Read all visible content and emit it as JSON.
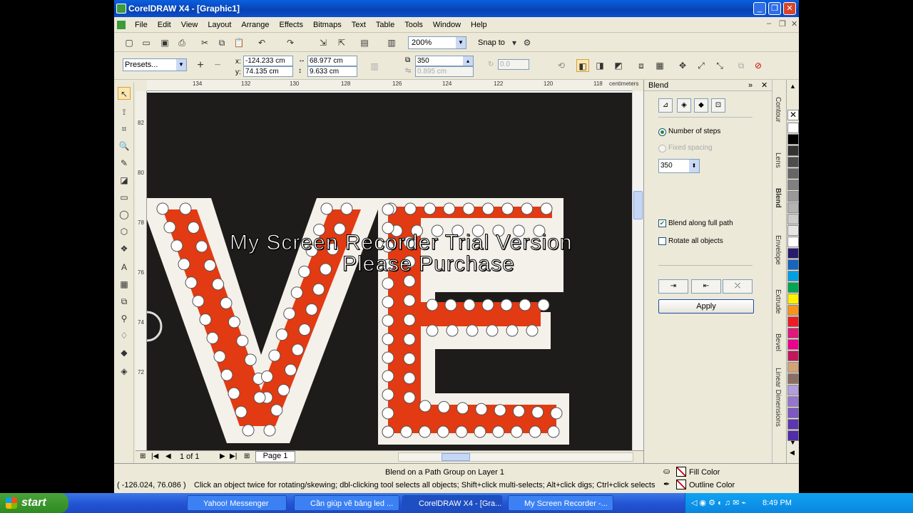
{
  "window": {
    "title": "CorelDRAW X4 - [Graphic1]"
  },
  "menu": [
    "File",
    "Edit",
    "View",
    "Layout",
    "Arrange",
    "Effects",
    "Bitmaps",
    "Text",
    "Table",
    "Tools",
    "Window",
    "Help"
  ],
  "toolbar": {
    "zoom": "200%",
    "snap_label": "Snap to"
  },
  "propbar": {
    "presets": "Presets...",
    "x_label": "x:",
    "y_label": "y:",
    "x": "-124.233 cm",
    "y": "74.135 cm",
    "width": "68.977 cm",
    "height": "9.633 cm",
    "steps": "350",
    "spacing": "0.895 cm",
    "angle": "0.0"
  },
  "ruler": {
    "top_ticks": [
      "134",
      "132",
      "130",
      "128",
      "126",
      "124",
      "122",
      "120",
      "118"
    ],
    "units": "centimeters",
    "left_ticks": [
      "82",
      "80",
      "78",
      "76",
      "74",
      "72"
    ]
  },
  "page_nav": {
    "count": "1 of 1",
    "tab": "Page 1"
  },
  "docker": {
    "title": "Blend",
    "number_of_steps": "Number of steps",
    "fixed_spacing": "Fixed spacing",
    "steps_value": "350",
    "blend_full_path": "Blend along full path",
    "rotate_all": "Rotate all objects",
    "apply": "Apply"
  },
  "side_tabs": [
    "Contour",
    "Lens",
    "Blend",
    "Envelope",
    "Extrude",
    "Bevel",
    "Linear Dimensions"
  ],
  "palette": [
    "#ffffff",
    "#000000",
    "#333333",
    "#4d4d4d",
    "#666666",
    "#808080",
    "#999999",
    "#b3b3b3",
    "#cccccc",
    "#e6e6e6",
    "#ffffff",
    "#2a1a6e",
    "#1565c0",
    "#00a0e0",
    "#00a651",
    "#fff200",
    "#f7941d",
    "#ed1c24",
    "#e0187a",
    "#ec008c",
    "#c2185b",
    "#d4a373",
    "#8d6e63",
    "#b39ddb",
    "#9575cd",
    "#7e57c2",
    "#5e35b1",
    "#512da8"
  ],
  "watermark": {
    "line1": "My Screen Recorder Trial Version",
    "line2": "Please Purchase"
  },
  "status": {
    "coords": "( -126.024, 76.086 )",
    "object_info": "Blend on a Path Group on Layer 1",
    "hint": "Click an object twice for rotating/skewing; dbl-clicking tool selects all objects; Shift+click multi-selects; Alt+click digs; Ctrl+click selects in a group",
    "fill_color": "Fill Color",
    "outline_color": "Outline Color"
  },
  "taskbar": {
    "start": "start",
    "tasks": [
      "Yahoo! Messenger",
      "Cần giúp vẽ bảng led ...",
      "CorelDRAW X4 - [Gra...",
      "My Screen Recorder -..."
    ],
    "clock": "8:49 PM"
  }
}
